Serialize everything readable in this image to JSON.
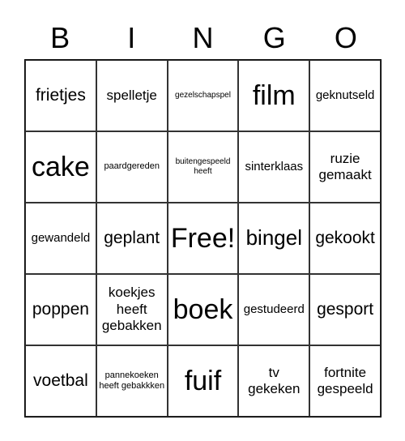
{
  "header": [
    "B",
    "I",
    "N",
    "G",
    "O"
  ],
  "cells": [
    [
      "frietjes",
      "spelletje",
      "gezelschapspel",
      "film",
      "geknutseld"
    ],
    [
      "cake",
      "paardgereden",
      "buitengespeeld heeft",
      "sinterklaas",
      "ruzie gemaakt"
    ],
    [
      "gewandeld",
      "geplant",
      "Free!",
      "bingel",
      "gekookt"
    ],
    [
      "poppen",
      "koekjes heeft gebakken",
      "boek",
      "gestudeerd",
      "gesport"
    ],
    [
      "voetbal",
      "pannekoeken heeft gebakkken",
      "fuif",
      "tv gekeken",
      "fortnite gespeeld"
    ]
  ]
}
